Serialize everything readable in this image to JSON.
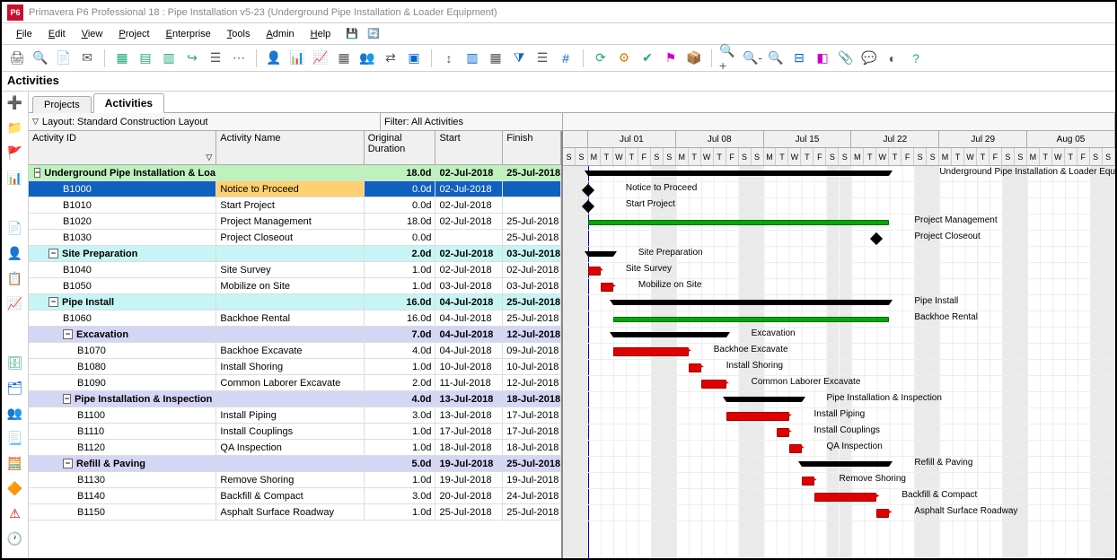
{
  "title": "Primavera P6 Professional 18 : Pipe Installation v5-23 (Underground Pipe Installation & Loader Equipment)",
  "menu": [
    "File",
    "Edit",
    "View",
    "Project",
    "Enterprise",
    "Tools",
    "Admin",
    "Help"
  ],
  "section": "Activities",
  "tabs": [
    "Projects",
    "Activities"
  ],
  "active_tab": 1,
  "layout_label": "Layout: Standard Construction Layout",
  "filter_label": "Filter: All Activities",
  "columns": {
    "id": "Activity ID",
    "name": "Activity Name",
    "dur": "Original Duration",
    "start": "Start",
    "finish": "Finish"
  },
  "weeks": [
    "Jul 01",
    "Jul 08",
    "Jul 15",
    "Jul 22",
    "Jul 29",
    "Aug 05"
  ],
  "day_letters": [
    "S",
    "S",
    "M",
    "T",
    "W",
    "T",
    "F"
  ],
  "rows": [
    {
      "id": "",
      "name": "Underground Pipe Installation & Loader Equipment",
      "dur": "18.0d",
      "start": "02-Jul-2018",
      "finish": "25-Jul-2018",
      "level": 0,
      "kind": "summary",
      "bar_start": 2,
      "bar_len": 24,
      "label": "Underground Pipe Installation & Loader Equipment",
      "label_off": 28
    },
    {
      "id": "B1000",
      "name": "Notice to Proceed",
      "dur": "0.0d",
      "start": "02-Jul-2018",
      "finish": "",
      "level": 2,
      "kind": "milestone",
      "bar_start": 2,
      "selected": true,
      "label": "Notice to Proceed",
      "label_off": 3
    },
    {
      "id": "B1010",
      "name": "Start Project",
      "dur": "0.0d",
      "start": "02-Jul-2018",
      "finish": "",
      "level": 2,
      "kind": "milestone",
      "bar_start": 2,
      "label": "Start Project",
      "label_off": 3
    },
    {
      "id": "B1020",
      "name": "Project Management",
      "dur": "18.0d",
      "start": "02-Jul-2018",
      "finish": "25-Jul-2018",
      "level": 2,
      "kind": "green",
      "bar_start": 2,
      "bar_len": 24,
      "label": "Project Management",
      "label_off": 26
    },
    {
      "id": "B1030",
      "name": "Project Closeout",
      "dur": "0.0d",
      "start": "",
      "finish": "25-Jul-2018",
      "level": 2,
      "kind": "milestone",
      "bar_start": 25,
      "label": "Project Closeout",
      "label_off": 3
    },
    {
      "id": "",
      "name": "Site Preparation",
      "dur": "2.0d",
      "start": "02-Jul-2018",
      "finish": "03-Jul-2018",
      "level": 1,
      "kind": "summary",
      "style": "cyan",
      "bar_start": 2,
      "bar_len": 2,
      "label": "Site Preparation",
      "label_off": 4
    },
    {
      "id": "B1040",
      "name": "Site Survey",
      "dur": "1.0d",
      "start": "02-Jul-2018",
      "finish": "02-Jul-2018",
      "level": 2,
      "kind": "red",
      "bar_start": 2,
      "bar_len": 1,
      "label": "Site Survey",
      "label_off": 3
    },
    {
      "id": "B1050",
      "name": "Mobilize on Site",
      "dur": "1.0d",
      "start": "03-Jul-2018",
      "finish": "03-Jul-2018",
      "level": 2,
      "kind": "red",
      "bar_start": 3,
      "bar_len": 1,
      "label": "Mobilize on Site",
      "label_off": 3
    },
    {
      "id": "",
      "name": "Pipe Install",
      "dur": "16.0d",
      "start": "04-Jul-2018",
      "finish": "25-Jul-2018",
      "level": 1,
      "kind": "summary",
      "style": "cyan",
      "bar_start": 4,
      "bar_len": 22,
      "label": "Pipe Install",
      "label_off": 24
    },
    {
      "id": "B1060",
      "name": "Backhoe Rental",
      "dur": "16.0d",
      "start": "04-Jul-2018",
      "finish": "25-Jul-2018",
      "level": 2,
      "kind": "green",
      "bar_start": 4,
      "bar_len": 22,
      "label": "Backhoe Rental",
      "label_off": 24
    },
    {
      "id": "",
      "name": "Excavation",
      "dur": "7.0d",
      "start": "04-Jul-2018",
      "finish": "12-Jul-2018",
      "level": 2,
      "kind": "summary",
      "style": "lav",
      "bar_start": 4,
      "bar_len": 9,
      "label": "Excavation",
      "label_off": 11
    },
    {
      "id": "B1070",
      "name": "Backhoe Excavate",
      "dur": "4.0d",
      "start": "04-Jul-2018",
      "finish": "09-Jul-2018",
      "level": 3,
      "kind": "red",
      "bar_start": 4,
      "bar_len": 6,
      "label": "Backhoe Excavate",
      "label_off": 8
    },
    {
      "id": "B1080",
      "name": "Install Shoring",
      "dur": "1.0d",
      "start": "10-Jul-2018",
      "finish": "10-Jul-2018",
      "level": 3,
      "kind": "red",
      "bar_start": 10,
      "bar_len": 1,
      "label": "Install Shoring",
      "label_off": 3
    },
    {
      "id": "B1090",
      "name": "Common Laborer Excavate",
      "dur": "2.0d",
      "start": "11-Jul-2018",
      "finish": "12-Jul-2018",
      "level": 3,
      "kind": "red",
      "bar_start": 11,
      "bar_len": 2,
      "label": "Common Laborer Excavate",
      "label_off": 4
    },
    {
      "id": "",
      "name": "Pipe Installation & Inspection",
      "dur": "4.0d",
      "start": "13-Jul-2018",
      "finish": "18-Jul-2018",
      "level": 2,
      "kind": "summary",
      "style": "lav",
      "bar_start": 13,
      "bar_len": 6,
      "label": "Pipe Installation & Inspection",
      "label_off": 8
    },
    {
      "id": "B1100",
      "name": "Install Piping",
      "dur": "3.0d",
      "start": "13-Jul-2018",
      "finish": "17-Jul-2018",
      "level": 3,
      "kind": "red",
      "bar_start": 13,
      "bar_len": 5,
      "label": "Install Piping",
      "label_off": 7
    },
    {
      "id": "B1110",
      "name": "Install Couplings",
      "dur": "1.0d",
      "start": "17-Jul-2018",
      "finish": "17-Jul-2018",
      "level": 3,
      "kind": "red",
      "bar_start": 17,
      "bar_len": 1,
      "label": "Install Couplings",
      "label_off": 3
    },
    {
      "id": "B1120",
      "name": "QA Inspection",
      "dur": "1.0d",
      "start": "18-Jul-2018",
      "finish": "18-Jul-2018",
      "level": 3,
      "kind": "red",
      "bar_start": 18,
      "bar_len": 1,
      "label": "QA Inspection",
      "label_off": 3
    },
    {
      "id": "",
      "name": "Refill & Paving",
      "dur": "5.0d",
      "start": "19-Jul-2018",
      "finish": "25-Jul-2018",
      "level": 2,
      "kind": "summary",
      "style": "lav",
      "bar_start": 19,
      "bar_len": 7,
      "label": "Refill & Paving",
      "label_off": 9
    },
    {
      "id": "B1130",
      "name": "Remove Shoring",
      "dur": "1.0d",
      "start": "19-Jul-2018",
      "finish": "19-Jul-2018",
      "level": 3,
      "kind": "red",
      "bar_start": 19,
      "bar_len": 1,
      "label": "Remove Shoring",
      "label_off": 3
    },
    {
      "id": "B1140",
      "name": "Backfill & Compact",
      "dur": "3.0d",
      "start": "20-Jul-2018",
      "finish": "24-Jul-2018",
      "level": 3,
      "kind": "red",
      "bar_start": 20,
      "bar_len": 5,
      "label": "Backfill & Compact",
      "label_off": 7
    },
    {
      "id": "B1150",
      "name": "Asphalt Surface Roadway",
      "dur": "1.0d",
      "start": "25-Jul-2018",
      "finish": "25-Jul-2018",
      "level": 3,
      "kind": "red",
      "bar_start": 25,
      "bar_len": 1,
      "label": "Asphalt Surface Roadway",
      "label_off": 3
    }
  ]
}
